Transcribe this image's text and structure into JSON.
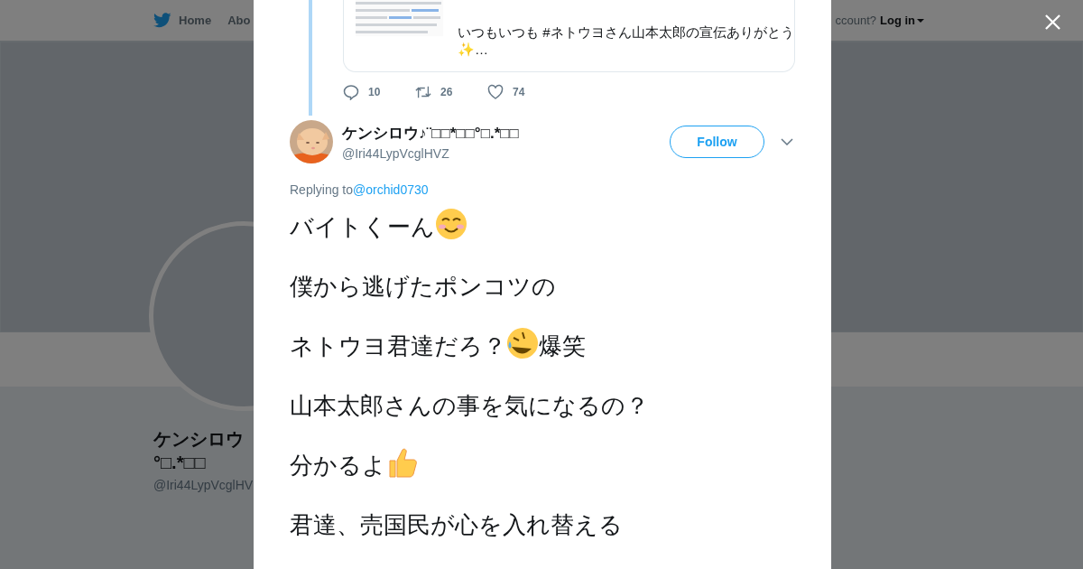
{
  "background_page": {
    "nav": {
      "items": [
        "Home",
        "Abo"
      ],
      "account_prompt": "ccount?",
      "login": "Log in"
    },
    "profile": {
      "name_lines": [
        "ケンシロウ",
        "°□.*□□"
      ],
      "handle": "@Iri44LypVcglHV"
    }
  },
  "modal": {
    "quoted_tweet": {
      "lines": [
        "いつもいつも #ネトウヨさん山本太郎の宣伝ありがとう",
        "✨…"
      ],
      "stats": {
        "replies": "10",
        "retweets": "26",
        "likes": "74"
      }
    },
    "tweet": {
      "name": "ケンシロウ♪¨□□*□□°□.*□□",
      "handle": "@Iri44LypVcglHVZ",
      "follow": "Follow",
      "replying_label": "Replying to",
      "replying_to": "@orchid0730",
      "lines": [
        [
          {
            "kind": "text",
            "text": "バイトくーん"
          },
          {
            "kind": "smile"
          }
        ],
        [
          {
            "kind": "text",
            "text": "僕から逃げたポンコツの"
          }
        ],
        [
          {
            "kind": "text",
            "text": "ネトウヨ君達だろ？"
          },
          {
            "kind": "laugh"
          },
          {
            "kind": "text",
            "text": "爆笑"
          }
        ],
        [
          {
            "kind": "text",
            "text": "山本太郎さんの事を気になるの？"
          }
        ],
        [
          {
            "kind": "text",
            "text": "分かるよ"
          },
          {
            "kind": "thumbsup"
          }
        ],
        [
          {
            "kind": "text",
            "text": "君達、売国民が心を入れ替える"
          }
        ]
      ]
    }
  }
}
